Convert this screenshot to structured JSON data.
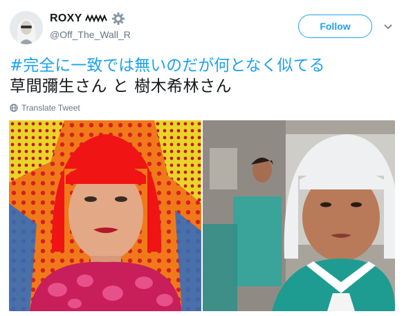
{
  "user": {
    "display_name": "ROXY",
    "handle": "@Off_The_Wall_R",
    "avatar_icon": "avatar-portrait-icon",
    "name_decorations": [
      "zigzag-emoji-icon",
      "gear-emoji-icon"
    ]
  },
  "follow_button": {
    "label": "Follow"
  },
  "menu": {
    "icon": "chevron-down-icon"
  },
  "tweet": {
    "hashtag": "#完全に一致では無いのだが何となく似てる",
    "line2": "草間彌生さん と 樹木希林さん"
  },
  "translate": {
    "label": "Translate Tweet",
    "icon": "globe-icon"
  },
  "media": {
    "photos": [
      {
        "subject": "red-bob-woman-polka-dot-photo"
      },
      {
        "subject": "white-bob-woman-sailor-uniform-photo"
      }
    ]
  },
  "colors": {
    "accent": "#1da1f2",
    "text": "#14171a",
    "secondary": "#657786"
  }
}
